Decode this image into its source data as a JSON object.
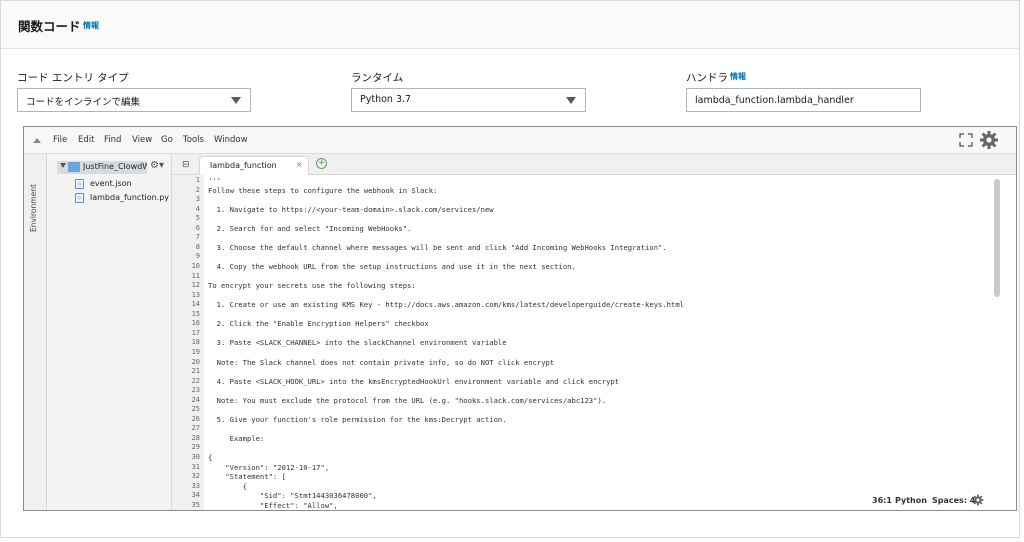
{
  "header": {
    "title": "関数コード",
    "info": "情報"
  },
  "fields": {
    "entry_type": {
      "label": "コード エントリ タイプ",
      "value": "コードをインラインで編集"
    },
    "runtime": {
      "label": "ランタイム",
      "value": "Python 3.7"
    },
    "handler": {
      "label": "ハンドラ",
      "info": "情報",
      "value": "lambda_function.lambda_handler"
    }
  },
  "ide": {
    "menu": [
      "File",
      "Edit",
      "Find",
      "View",
      "Go",
      "Tools",
      "Window"
    ],
    "side_tab": "Environment",
    "tree": {
      "root": "JustFine_ClowdW",
      "files": [
        "event.json",
        "lambda_function.py"
      ]
    },
    "tab": {
      "label": "lambda_function",
      "close": "×",
      "add": "+"
    },
    "lines": [
      {
        "n": "1",
        "t": "'''"
      },
      {
        "n": "2",
        "t": "Follow these steps to configure the webhook in Slack:"
      },
      {
        "n": "3",
        "t": ""
      },
      {
        "n": "4",
        "t": "  1. Navigate to https://<your-team-domain>.slack.com/services/new"
      },
      {
        "n": "5",
        "t": ""
      },
      {
        "n": "6",
        "t": "  2. Search for and select \"Incoming WebHooks\"."
      },
      {
        "n": "7",
        "t": ""
      },
      {
        "n": "8",
        "t": "  3. Choose the default channel where messages will be sent and click \"Add Incoming WebHooks Integration\"."
      },
      {
        "n": "9",
        "t": ""
      },
      {
        "n": "10",
        "t": "  4. Copy the webhook URL from the setup instructions and use it in the next section."
      },
      {
        "n": "11",
        "t": ""
      },
      {
        "n": "12",
        "t": "To encrypt your secrets use the following steps:"
      },
      {
        "n": "13",
        "t": ""
      },
      {
        "n": "14",
        "t": "  1. Create or use an existing KMS Key - http://docs.aws.amazon.com/kms/latest/developerguide/create-keys.html"
      },
      {
        "n": "15",
        "t": ""
      },
      {
        "n": "16",
        "t": "  2. Click the \"Enable Encryption Helpers\" checkbox"
      },
      {
        "n": "17",
        "t": ""
      },
      {
        "n": "18",
        "t": "  3. Paste <SLACK_CHANNEL> into the slackChannel environment variable"
      },
      {
        "n": "19",
        "t": ""
      },
      {
        "n": "20",
        "t": "  Note: The Slack channel does not contain private info, so do NOT click encrypt"
      },
      {
        "n": "21",
        "t": ""
      },
      {
        "n": "22",
        "t": "  4. Paste <SLACK_HOOK_URL> into the kmsEncryptedHookUrl environment variable and click encrypt"
      },
      {
        "n": "23",
        "t": ""
      },
      {
        "n": "24",
        "t": "  Note: You must exclude the protocol from the URL (e.g. \"hooks.slack.com/services/abc123\")."
      },
      {
        "n": "25",
        "t": ""
      },
      {
        "n": "26",
        "t": "  5. Give your function's role permission for the kms:Decrypt action."
      },
      {
        "n": "27",
        "t": ""
      },
      {
        "n": "28",
        "t": "     Example:"
      },
      {
        "n": "29",
        "t": ""
      },
      {
        "n": "30",
        "t": "{"
      },
      {
        "n": "31",
        "t": "    \"Version\": \"2012-10-17\","
      },
      {
        "n": "32",
        "t": "    \"Statement\": ["
      },
      {
        "n": "33",
        "t": "        {"
      },
      {
        "n": "34",
        "t": "            \"Sid\": \"Stmt1443036478000\","
      },
      {
        "n": "35",
        "t": "            \"Effect\": \"Allow\","
      }
    ],
    "status": {
      "position": "36:1",
      "language": "Python",
      "spaces": "Spaces: 4"
    }
  }
}
